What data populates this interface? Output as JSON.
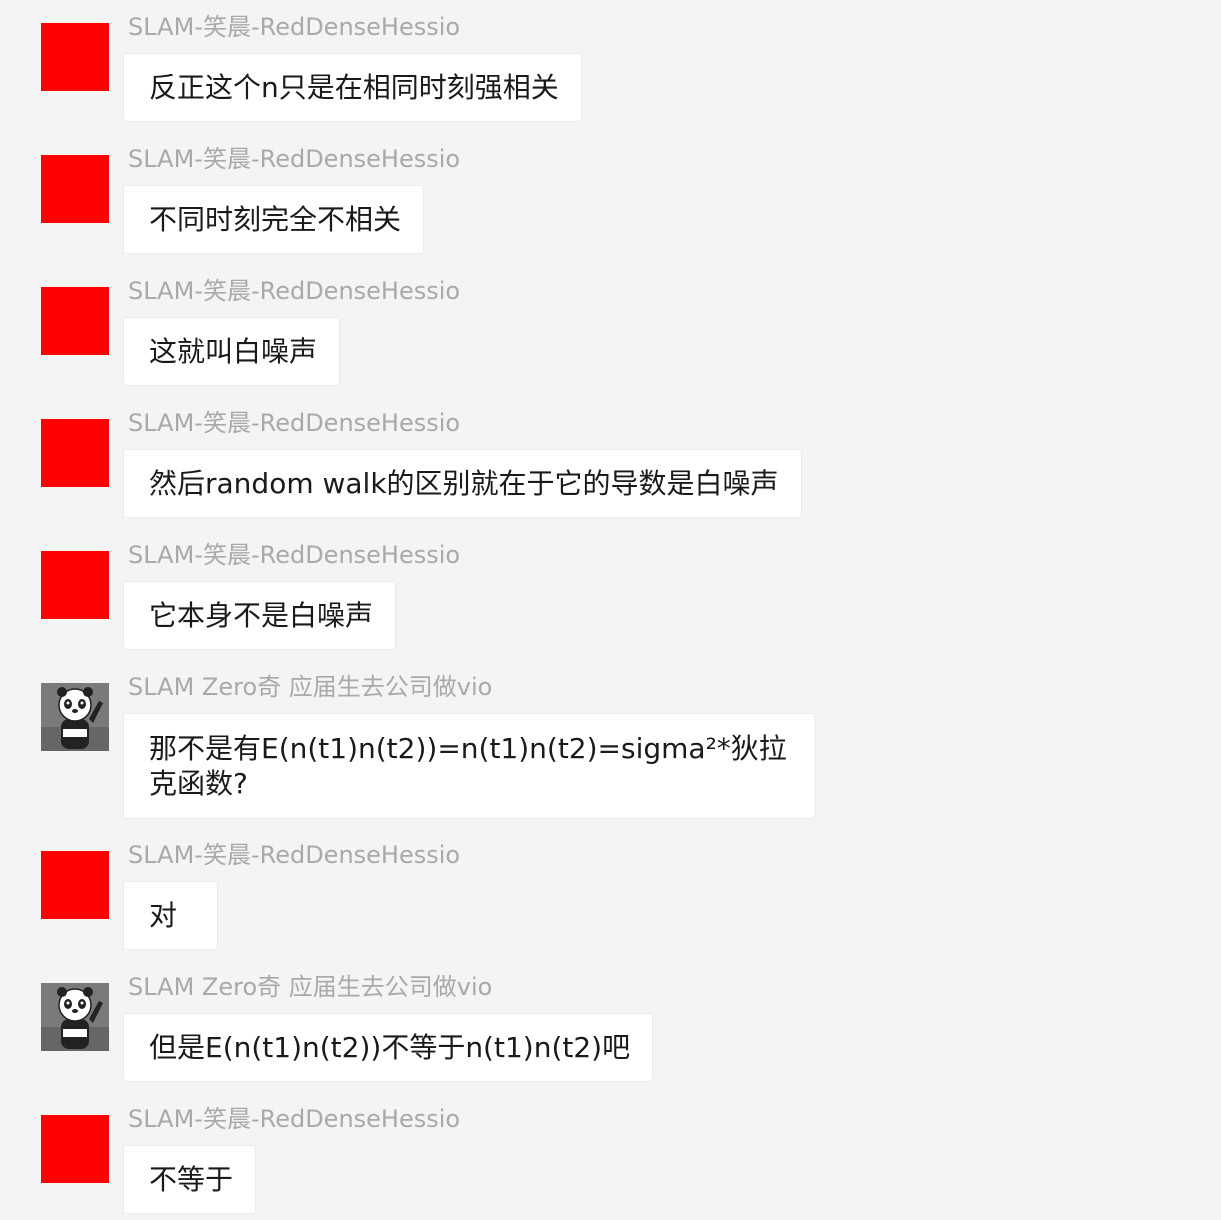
{
  "messages": [
    {
      "sender": "SLAM-笑晨-RedDenseHessio",
      "avatar": "red-square-avatar",
      "text": "反正这个n只是在相同时刻强相关"
    },
    {
      "sender": "SLAM-笑晨-RedDenseHessio",
      "avatar": "red-square-avatar",
      "text": "不同时刻完全不相关"
    },
    {
      "sender": "SLAM-笑晨-RedDenseHessio",
      "avatar": "red-square-avatar",
      "text": "这就叫白噪声"
    },
    {
      "sender": "SLAM-笑晨-RedDenseHessio",
      "avatar": "red-square-avatar",
      "text": "然后random walk的区别就在于它的导数是白噪声"
    },
    {
      "sender": "SLAM-笑晨-RedDenseHessio",
      "avatar": "red-square-avatar",
      "text": "它本身不是白噪声"
    },
    {
      "sender": "SLAM Zero奇 应届生去公司做vio",
      "avatar": "panda-avatar",
      "text": "那不是有E(n(t1)n(t2))=n(t1)n(t2)=sigma²*狄拉克函数?"
    },
    {
      "sender": "SLAM-笑晨-RedDenseHessio",
      "avatar": "red-square-avatar",
      "text": "对"
    },
    {
      "sender": "SLAM Zero奇 应届生去公司做vio",
      "avatar": "panda-avatar",
      "text": "但是E(n(t1)n(t2))不等于n(t1)n(t2)吧"
    },
    {
      "sender": "SLAM-笑晨-RedDenseHessio",
      "avatar": "red-square-avatar",
      "text": "不等于"
    }
  ],
  "colors": {
    "background": "#f4f4f4",
    "bubble": "#ffffff",
    "sender_name": "#a9a9a9",
    "red_avatar": "#ff0000"
  }
}
